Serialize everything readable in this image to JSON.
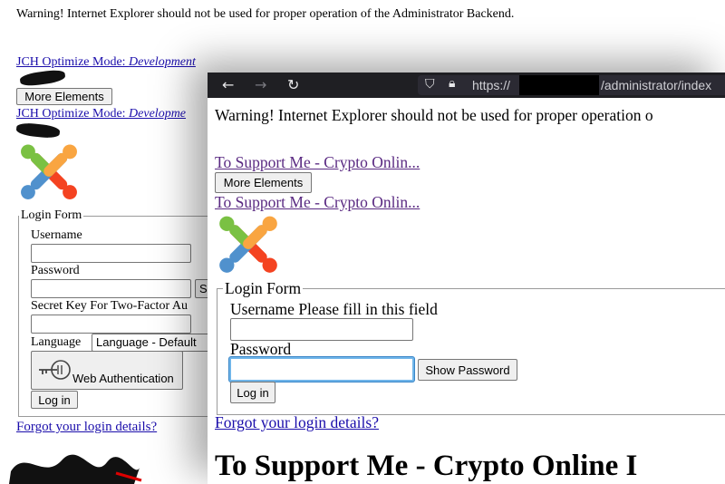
{
  "back_page": {
    "warning": "Warning! Internet Explorer should not be used for proper operation of the Administrator Backend.",
    "jch_label": "JCH Optimize Mode: ",
    "jch_mode_1": "Development",
    "more_elements": "More Elements",
    "jch_mode_2": "Developme",
    "login_legend": "Login Form",
    "username_label": "Username",
    "password_label": "Password",
    "show_button_partial": "S",
    "secret_key_label": "Secret Key For Two-Factor Au",
    "language_label": "Language",
    "language_value": "Language - Default",
    "web_auth": "Web Authentication",
    "login_button": "Log in",
    "forgot": "Forgot your login details?"
  },
  "front_window": {
    "url_prefix": "https://",
    "url_suffix": "/administrator/index",
    "warning": "Warning! Internet Explorer should not be used for proper operation o",
    "support_link_1": "To Support Me - Crypto Onlin...",
    "more_elements": "More Elements",
    "support_link_2": "To Support Me - Crypto Onlin...",
    "login_legend": "Login Form",
    "username_label": "Username Please fill in this field",
    "password_label": "Password",
    "show_password": "Show Password",
    "login_button": "Log in",
    "forgot": "Forgot your login details?",
    "big_heading": "To Support Me - Crypto Online I"
  },
  "colors": {
    "link": "#1a0dab",
    "visited_link": "#5a2a82",
    "focus_ring": "#6fb5e9",
    "chrome_bg": "#1f1f23"
  }
}
